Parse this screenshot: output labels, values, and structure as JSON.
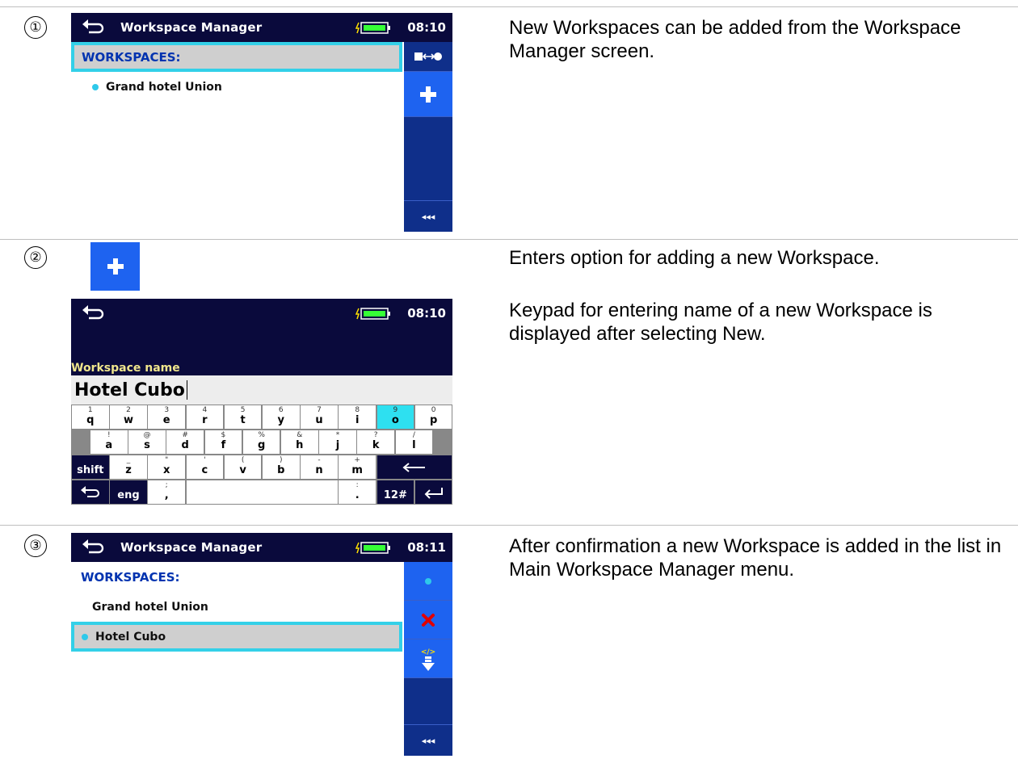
{
  "steps": [
    {
      "number": "①",
      "description": "New Workspaces can be added from the Workspace Manager screen."
    },
    {
      "number": "②",
      "description_1": "Enters option for adding a new Workspace.",
      "description_2": "Keypad for entering name of a new Workspace is displayed after selecting New."
    },
    {
      "number": "③",
      "description": "After confirmation a new Workspace is added in the list in Main Workspace Manager menu."
    }
  ],
  "screen1": {
    "title": "Workspace Manager",
    "time": "08:10",
    "header": "WORKSPACES:",
    "items": [
      "Grand hotel Union"
    ],
    "sidebar": [
      "open-icon",
      "add-icon",
      "more-icon"
    ],
    "more_label": "◂◂◂"
  },
  "screen2": {
    "time": "08:10",
    "field_label": "Workspace name",
    "field_value": "Hotel Cubo",
    "keys": {
      "row1": [
        [
          "1",
          "q"
        ],
        [
          "2",
          "w"
        ],
        [
          "3",
          "e"
        ],
        [
          "4",
          "r"
        ],
        [
          "5",
          "t"
        ],
        [
          "6",
          "y"
        ],
        [
          "7",
          "u"
        ],
        [
          "8",
          "i"
        ],
        [
          "9",
          "o"
        ],
        [
          "0",
          "p"
        ]
      ],
      "row2": [
        [
          "!",
          "a"
        ],
        [
          "@",
          "s"
        ],
        [
          "#",
          "d"
        ],
        [
          "$",
          "f"
        ],
        [
          "%",
          "g"
        ],
        [
          "&",
          "h"
        ],
        [
          "*",
          "j"
        ],
        [
          "?",
          "k"
        ],
        [
          "/",
          "l"
        ]
      ],
      "row3": [
        [
          "_",
          "z"
        ],
        [
          "\"",
          "x"
        ],
        [
          "'",
          "c"
        ],
        [
          "(",
          "v"
        ],
        [
          ")",
          "b"
        ],
        [
          "-",
          "n"
        ],
        [
          "+",
          "m"
        ]
      ],
      "shift": "shift",
      "lang": "eng",
      "comma_alt": ";",
      "comma": ",",
      "dot_alt": ":",
      "dot": ".",
      "num": "12#"
    }
  },
  "screen3": {
    "title": "Workspace Manager",
    "time": "08:11",
    "header": "WORKSPACES:",
    "items": [
      "Grand hotel Union",
      "Hotel Cubo"
    ],
    "sidebar": [
      "select-icon",
      "delete-icon",
      "export-icon",
      "more-icon"
    ],
    "more_label": "◂◂◂"
  },
  "colors": {
    "topbar": "#0a0a3c",
    "accent_blue": "#1e63f0",
    "selection": "#33d0e8",
    "header_text": "#0033b0",
    "label_yellow": "#f0e68c"
  }
}
